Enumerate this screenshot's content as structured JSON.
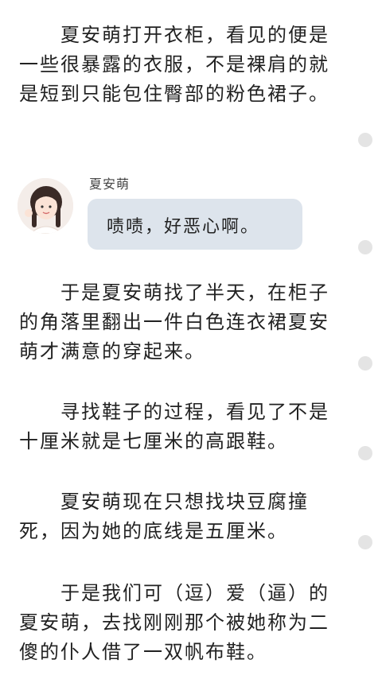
{
  "paragraphs": [
    {
      "text": "　　夏安萌打开衣柜，看见的便是一些很暴露的衣服，不是裸肩的就是短到只能包住臀部的粉色裙子。"
    },
    {
      "text": "　　于是夏安萌找了半天，在柜子的角落里翻出一件白色连衣裙夏安萌才满意的穿起来。"
    },
    {
      "text": "　　寻找鞋子的过程，看见了不是十厘米就是七厘米的高跟鞋。"
    },
    {
      "text": "　　夏安萌现在只想找块豆腐撞死，因为她的底线是五厘米。"
    },
    {
      "text": "　　于是我们可（逗）爱（逼）的夏安萌，去找刚刚那个被她称为二傻的仆人借了一双帆布鞋。"
    }
  ],
  "chat": {
    "speaker": "夏安萌",
    "message": "啧啧，好恶心啊。",
    "bubble_color": "#dde4ec"
  },
  "scroll_dots": [
    "dot",
    "dot",
    "dot",
    "dot",
    "dot"
  ]
}
